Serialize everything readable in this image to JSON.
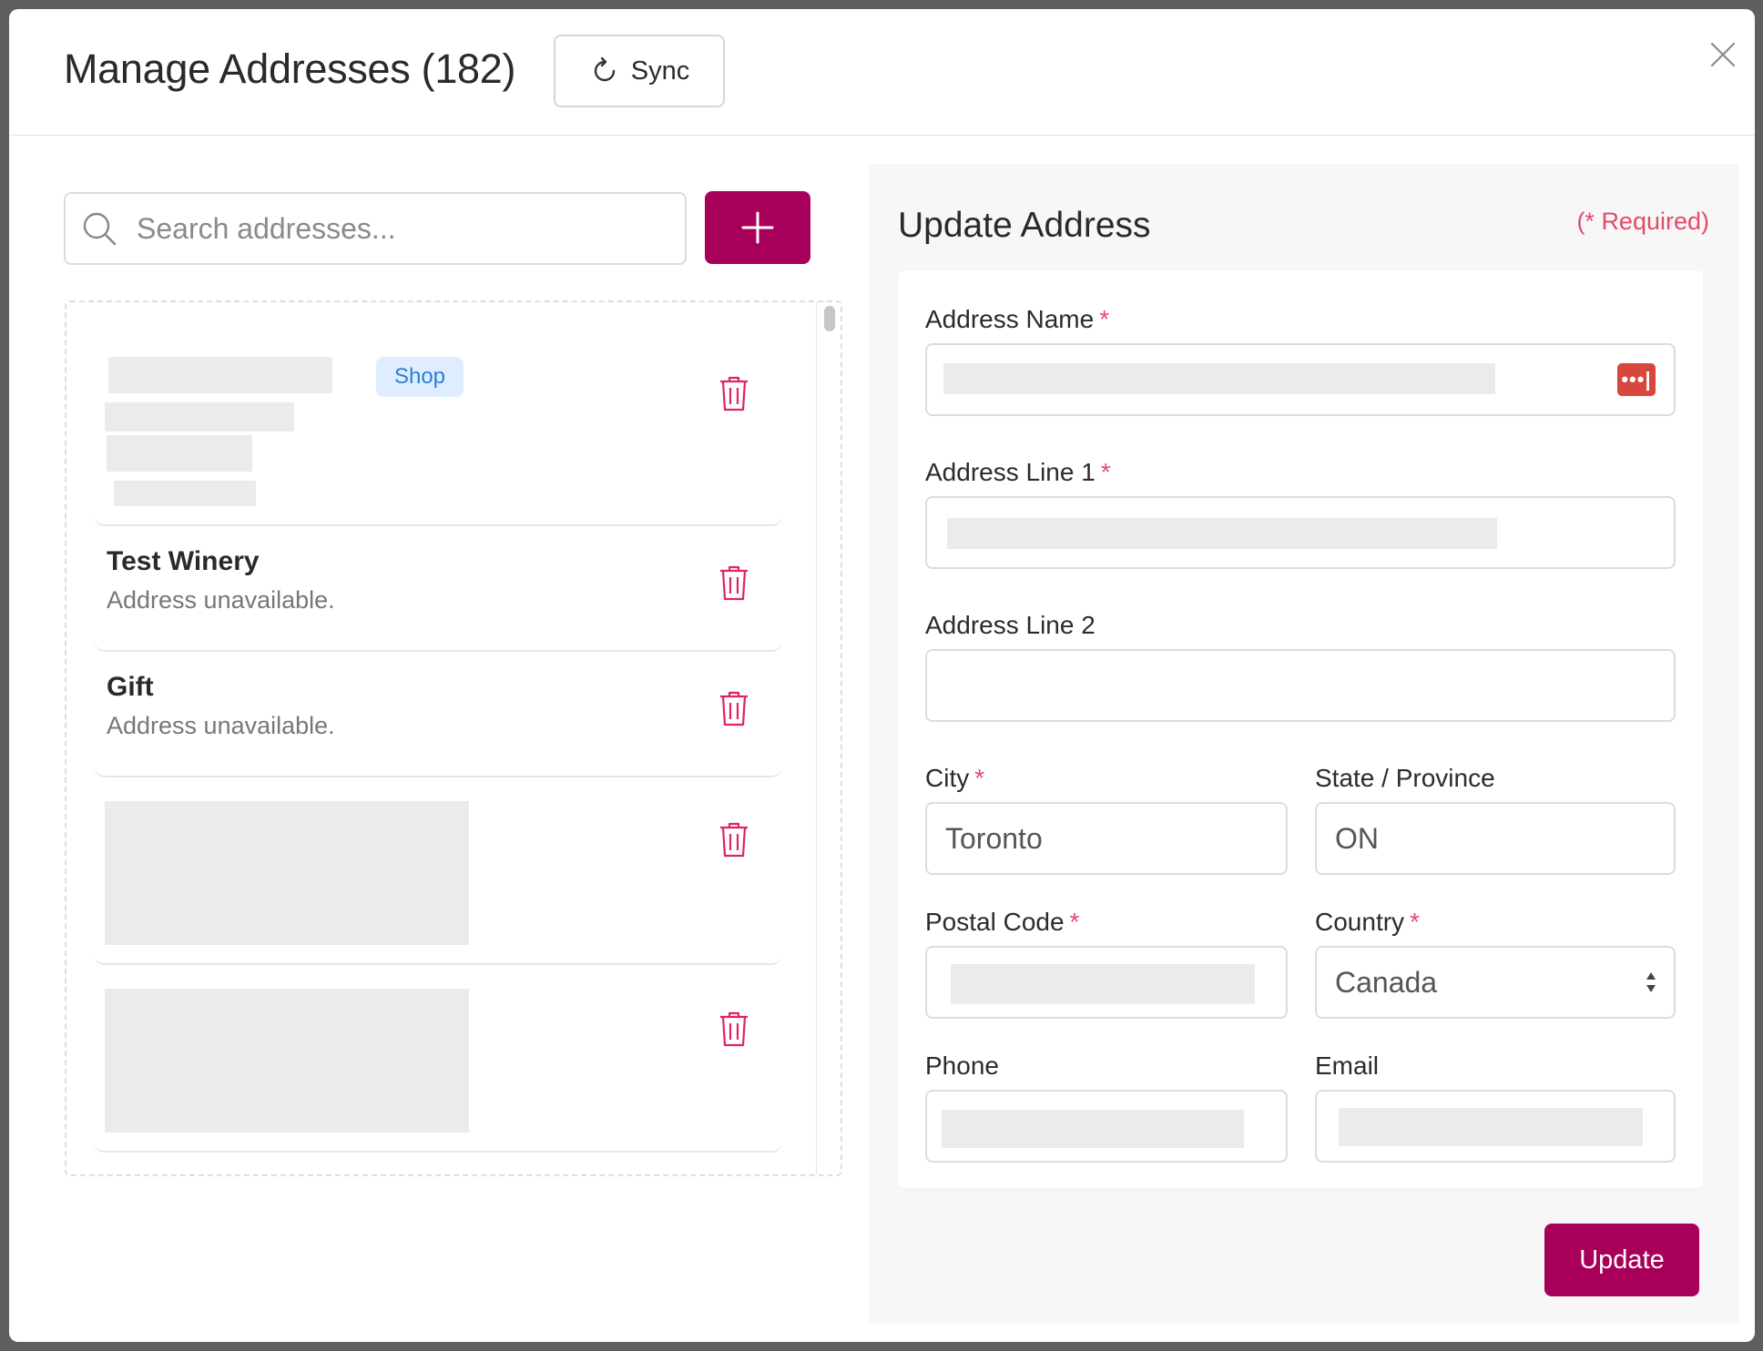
{
  "header": {
    "title": "Manage Addresses (182)",
    "sync_label": "Sync"
  },
  "search": {
    "placeholder": "Search addresses..."
  },
  "address_list": {
    "items": [
      {
        "name": "",
        "badge": "Shop",
        "subtitle": ""
      },
      {
        "name": "Test Winery",
        "subtitle": "Address unavailable."
      },
      {
        "name": "Gift",
        "subtitle": "Address unavailable."
      },
      {
        "name": "",
        "subtitle": ""
      },
      {
        "name": "",
        "subtitle": ""
      }
    ]
  },
  "form": {
    "title": "Update Address",
    "required_note": "(* Required)",
    "required_star": "*",
    "address_name_label": "Address Name",
    "address_line1_label": "Address Line 1",
    "address_line2_label": "Address Line 2",
    "address_line2_value": "",
    "city_label": "City",
    "city_value": "Toronto",
    "state_label": "State / Province",
    "state_value": "ON",
    "postal_label": "Postal Code",
    "country_label": "Country",
    "country_value": "Canada",
    "phone_label": "Phone",
    "email_label": "Email",
    "password_manager_icon_text": "•••|",
    "update_label": "Update"
  },
  "colors": {
    "primary": "#a8005a",
    "required": "#e24a6a",
    "badge_bg": "#dfeeff",
    "badge_text": "#2a7fd9",
    "trash": "#e0245e"
  }
}
